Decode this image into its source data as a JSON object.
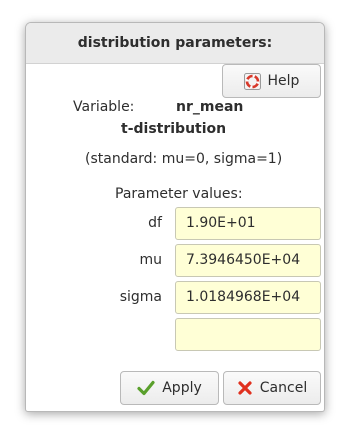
{
  "dialog": {
    "title": "distribution parameters:",
    "help_label": "Help",
    "variable_label": "Variable:",
    "variable_name": "nr_mean",
    "distribution": "t-distribution",
    "standard_note": "(standard: mu=0, sigma=1)",
    "params_heading": "Parameter values:",
    "params": [
      {
        "label": "df",
        "value": "1.90E+01"
      },
      {
        "label": "mu",
        "value": "7.3946450E+04"
      },
      {
        "label": "sigma",
        "value": "1.0184968E+04"
      },
      {
        "label": "",
        "value": ""
      }
    ],
    "apply_label": "Apply",
    "cancel_label": "Cancel"
  },
  "icons": {
    "help": "lifebuoy-icon",
    "apply": "checkmark-icon",
    "cancel": "x-mark-icon"
  },
  "colors": {
    "field_background": "#ffffd6",
    "apply_check": "#5aa02c",
    "cancel_x": "#e0301e",
    "help_ring": "#d8382a"
  }
}
